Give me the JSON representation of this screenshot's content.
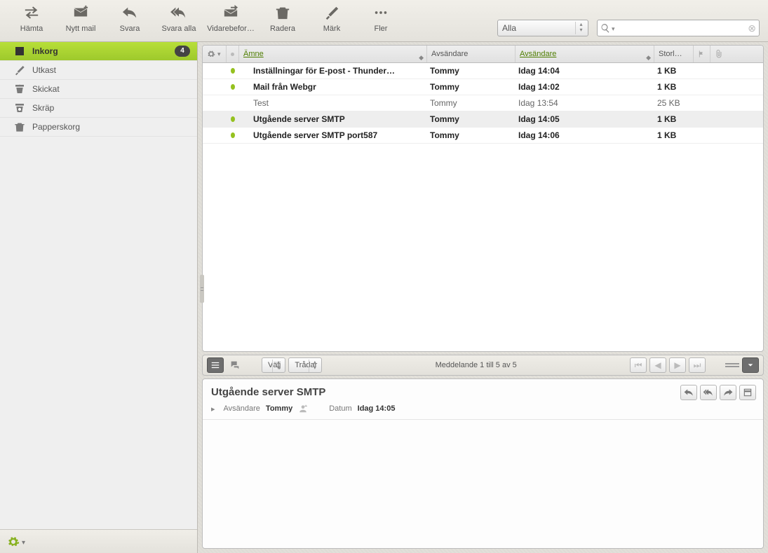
{
  "toolbar": {
    "get": "Hämta",
    "compose": "Nytt mail",
    "reply": "Svara",
    "replyall": "Svara alla",
    "forward": "Vidarebefor…",
    "delete": "Radera",
    "mark": "Märk",
    "more": "Fler"
  },
  "filter_sel": "Alla",
  "search_placeholder": "",
  "folders": [
    {
      "id": "inbox",
      "label": "Inkorg",
      "icon": "inbox",
      "active": true,
      "badge": 4
    },
    {
      "id": "drafts",
      "label": "Utkast",
      "icon": "pencil",
      "active": false
    },
    {
      "id": "sent",
      "label": "Skickat",
      "icon": "sent",
      "active": false
    },
    {
      "id": "junk",
      "label": "Skräp",
      "icon": "junk",
      "active": false
    },
    {
      "id": "trash",
      "label": "Papperskorg",
      "icon": "trash",
      "active": false
    }
  ],
  "columns": {
    "subject": "Ämne",
    "from": "Avsändare",
    "date": "Avsändare",
    "size": "Storl…"
  },
  "messages": [
    {
      "unread": true,
      "sel": false,
      "subject": "Inställningar för E-post - Thunder…",
      "from": "Tommy",
      "date": "Idag 14:04",
      "size": "1 KB"
    },
    {
      "unread": true,
      "sel": false,
      "subject": "Mail från Webgr",
      "from": "Tommy",
      "date": "Idag 14:02",
      "size": "1 KB"
    },
    {
      "unread": false,
      "sel": false,
      "subject": "Test",
      "from": "Tommy",
      "date": "Idag 13:54",
      "size": "25 KB"
    },
    {
      "unread": true,
      "sel": true,
      "subject": "Utgående server SMTP",
      "from": "Tommy",
      "date": "Idag 14:05",
      "size": "1 KB"
    },
    {
      "unread": true,
      "sel": false,
      "subject": "Utgående server SMTP port587",
      "from": "Tommy",
      "date": "Idag 14:06",
      "size": "1 KB"
    }
  ],
  "midbar": {
    "select": "Välj",
    "threads": "Trådar",
    "status": "Meddelande 1 till 5 av 5"
  },
  "preview": {
    "subject": "Utgående server SMTP",
    "from_label": "Avsändare",
    "from_value": "Tommy",
    "date_label": "Datum",
    "date_value": "Idag 14:05"
  }
}
